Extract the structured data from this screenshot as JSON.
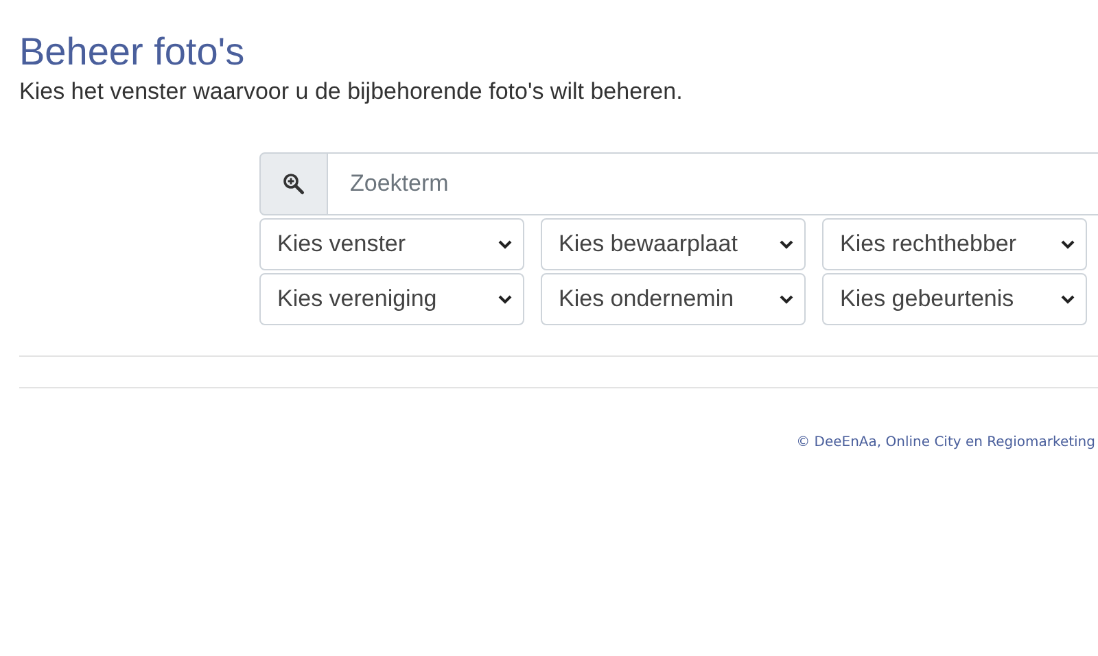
{
  "heading": "Beheer foto's",
  "intro": "Kies het venster waarvoor u de bijbehorende foto's wilt beheren.",
  "search": {
    "placeholder": "Zoekterm"
  },
  "filters": [
    {
      "label": "Kies venster"
    },
    {
      "label": "Kies bewaarplaat"
    },
    {
      "label": "Kies rechthebber"
    },
    {
      "label": "Kies vereniging"
    },
    {
      "label": "Kies ondernemin"
    },
    {
      "label": "Kies gebeurtenis"
    }
  ],
  "footer": "© DeeEnAa, Online City en Regiomarketing"
}
